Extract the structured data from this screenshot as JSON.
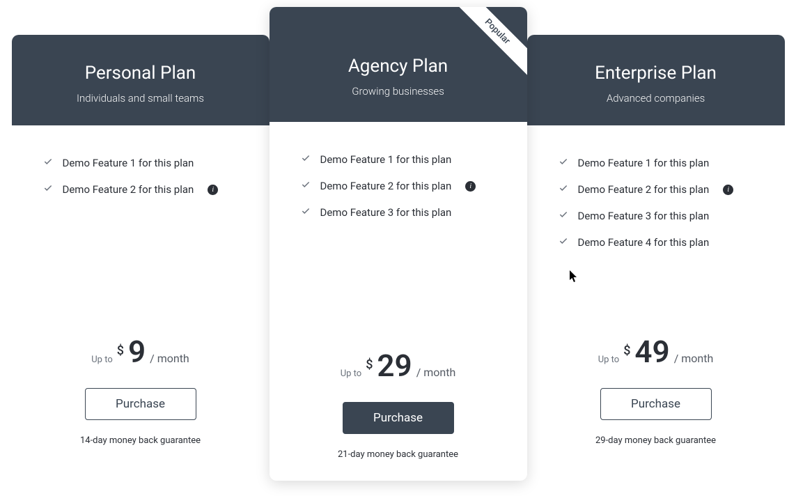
{
  "ribbon_label": "Popular",
  "price_prefix": "Up to",
  "price_currency": "$",
  "price_suffix": "/ month",
  "purchase_label": "Purchase",
  "plans": [
    {
      "title": "Personal Plan",
      "subtitle": "Individuals and small teams",
      "features": [
        {
          "text": "Demo Feature 1 for this plan",
          "info": false
        },
        {
          "text": "Demo Feature 2 for this plan",
          "info": true
        }
      ],
      "price": "9",
      "guarantee": "14-day money back guarantee",
      "featured": false
    },
    {
      "title": "Agency Plan",
      "subtitle": "Growing businesses",
      "features": [
        {
          "text": "Demo Feature 1 for this plan",
          "info": false
        },
        {
          "text": "Demo Feature 2 for this plan",
          "info": true
        },
        {
          "text": "Demo Feature 3 for this plan",
          "info": false
        }
      ],
      "price": "29",
      "guarantee": "21-day money back guarantee",
      "featured": true
    },
    {
      "title": "Enterprise Plan",
      "subtitle": "Advanced companies",
      "features": [
        {
          "text": "Demo Feature 1 for this plan",
          "info": false
        },
        {
          "text": "Demo Feature 2 for this plan",
          "info": true
        },
        {
          "text": "Demo Feature 3 for this plan",
          "info": false
        },
        {
          "text": "Demo Feature 4 for this plan",
          "info": false
        }
      ],
      "price": "49",
      "guarantee": "29-day money back guarantee",
      "featured": false
    }
  ]
}
